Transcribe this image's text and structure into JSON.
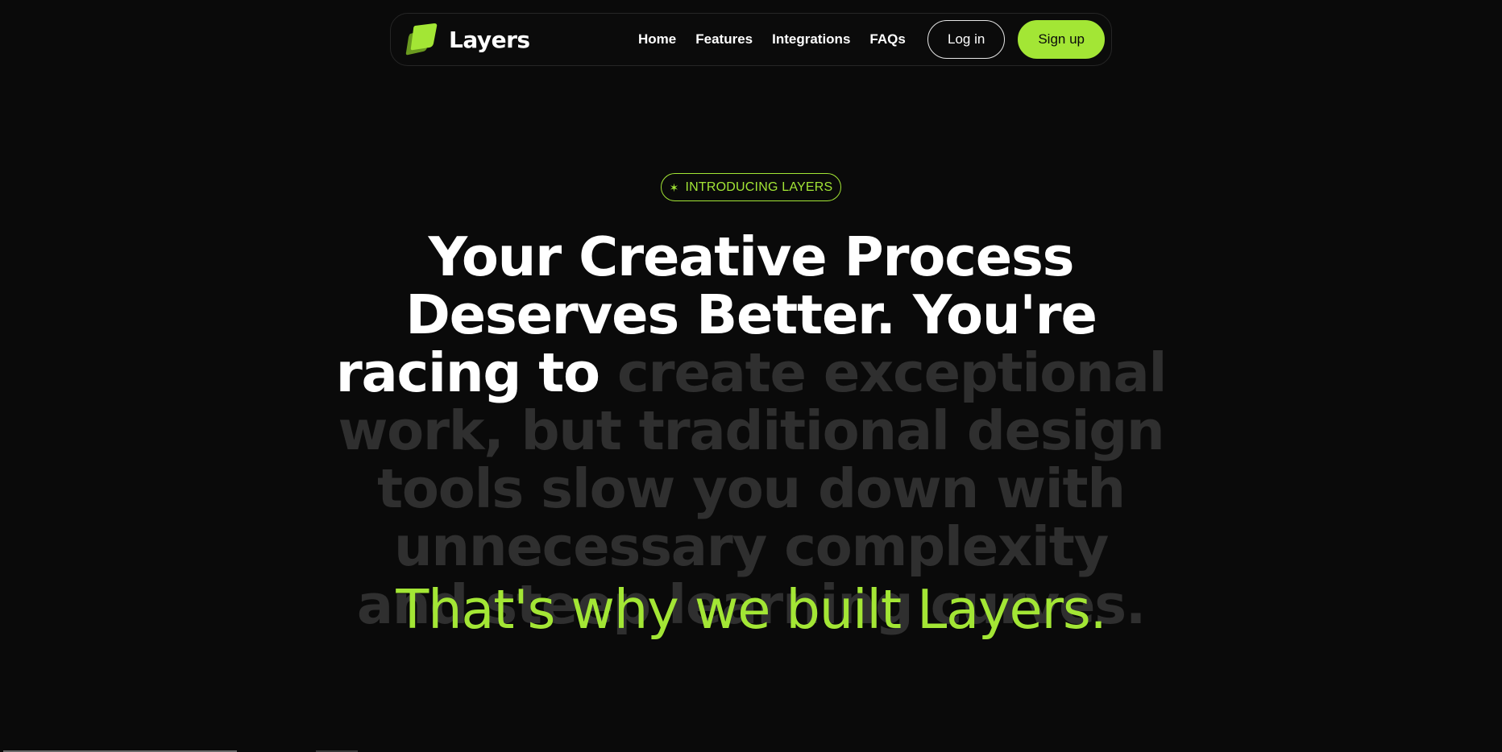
{
  "brand": {
    "name": "Layers",
    "logo_icon": "layers-logo-icon",
    "accent_color": "#a3e635"
  },
  "nav": {
    "links": [
      "Home",
      "Features",
      "Integrations",
      "FAQs"
    ],
    "login_label": "Log in",
    "signup_label": "Sign up"
  },
  "hero": {
    "badge_icon": "sparkle-icon",
    "badge_glyph": "✶",
    "badge_label": "INTRODUCING LAYERS",
    "headline_bright": "Your Creative Process Deserves Better. You're racing to",
    "headline_dim": "create exceptional work, but traditional design tools slow you down with unnecessary complexity and steep learning curves.",
    "tagline": "That's why we built Layers."
  },
  "colors": {
    "background": "#0a0a0a",
    "text": "#ffffff",
    "dim_text": "#2f2f2f",
    "accent": "#a3e635"
  }
}
